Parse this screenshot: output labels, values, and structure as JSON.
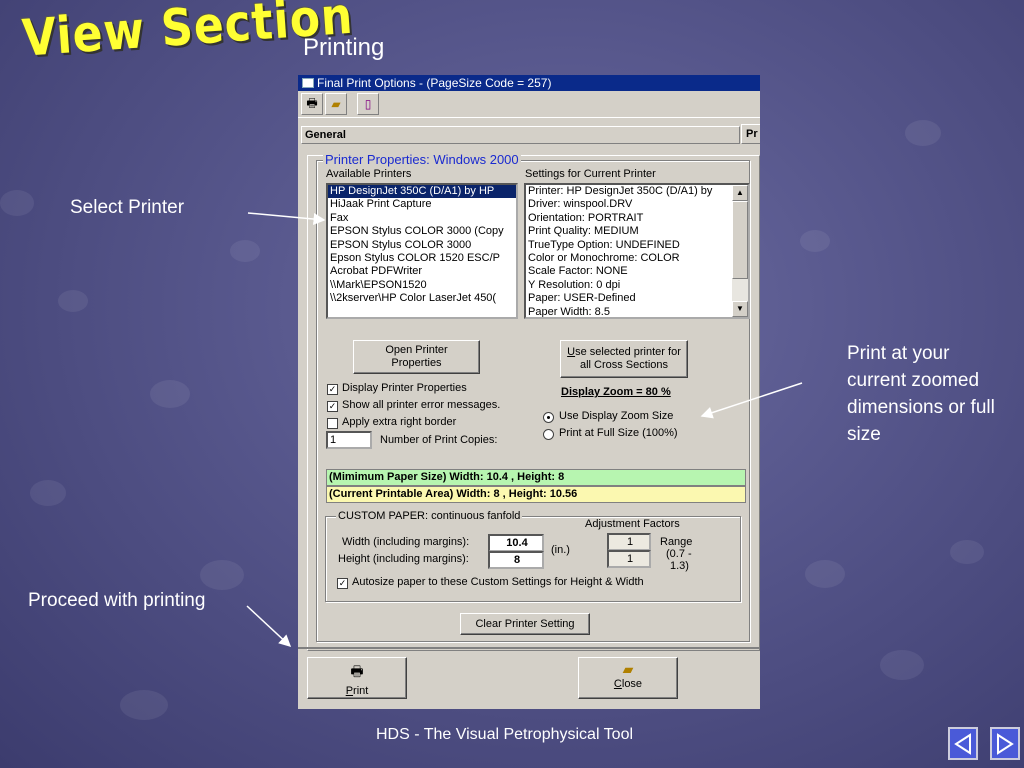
{
  "slide": {
    "deco_title": "View Section",
    "subtitle": "Printing",
    "annotations": {
      "select_printer": "Select Printer",
      "print_zoom": "Print  at your current zoomed dimensions or full size",
      "proceed": "Proceed with printing"
    },
    "footer": "HDS - The Visual Petrophysical Tool",
    "nav": {
      "prev_icon": "triangle-left-icon",
      "next_icon": "triangle-right-icon"
    }
  },
  "dialog": {
    "title": "Final Print Options - (PageSize Code = 257)",
    "toolbar_icons": [
      "printer-icon",
      "open-folder-icon",
      "page-icon"
    ],
    "tabs": [
      "General",
      "Pr"
    ],
    "printer_group_title": "Printer Properties:  Windows 2000",
    "available_label": "Available Printers",
    "settings_label": "Settings for Current Printer",
    "printers": [
      "HP DesignJet 350C (D/A1) by HP",
      "HiJaak Print Capture",
      "Fax",
      "EPSON Stylus COLOR 3000 (Copy",
      "EPSON Stylus COLOR 3000",
      "Epson Stylus COLOR 1520 ESC/P",
      "Acrobat PDFWriter",
      "\\\\Mark\\EPSON1520",
      "\\\\2kserver\\HP Color LaserJet 450("
    ],
    "settings": [
      "Printer: HP DesignJet 350C (D/A1) by",
      "Driver: winspool.DRV",
      "Orientation: PORTRAIT",
      "Print Quality: MEDIUM",
      "TrueType Option: UNDEFINED",
      "Color or Monochrome: COLOR",
      "Scale Factor: NONE",
      "Y Resolution: 0 dpi",
      "Paper: USER-Defined",
      "Paper Width: 8.5"
    ],
    "open_props_btn": "Open Printer Properties",
    "use_selected_btn_u": "U",
    "use_selected_btn_rest": "se selected printer for all Cross Sections",
    "checkboxes": [
      {
        "label": "Display Printer Properties",
        "checked": "✓"
      },
      {
        "label": "Show all printer error messages.",
        "checked": "✓"
      },
      {
        "label": "Apply extra right border",
        "checked": ""
      }
    ],
    "copies_value": "1",
    "copies_label": "Number of Print Copies:",
    "zoom_heading": "Display Zoom = 80 %",
    "radio_zoom": "Use Display Zoom Size",
    "radio_full": "Print at Full Size (100%)",
    "min_paper": "(Mimimum Paper Size)  Width: 10.4 ,  Height: 8",
    "current_area": "(Current Printable Area)  Width: 8 ,  Height: 10.56",
    "min_paper_color": "#b7f5b0",
    "current_area_color": "#fbf8b0",
    "custom_title": "CUSTOM PAPER: continuous fanfold",
    "adjust_label": "Adjustment Factors",
    "width_label": "Width (including margins):",
    "height_label": "Height (including margins):",
    "width_value": "10.4",
    "height_value": "8",
    "unit": "(in.)",
    "adj_width": "1",
    "adj_height": "1",
    "range_label": "Range",
    "range_value": "(0.7 -",
    "range_value2": "1.3)",
    "autosize_label": "Autosize paper to these Custom Settings for Height & Width",
    "clear_btn": "Clear Printer Setting",
    "print_btn_u": "P",
    "print_btn_rest": "rint",
    "close_btn_u": "C",
    "close_btn_rest": "lose"
  }
}
